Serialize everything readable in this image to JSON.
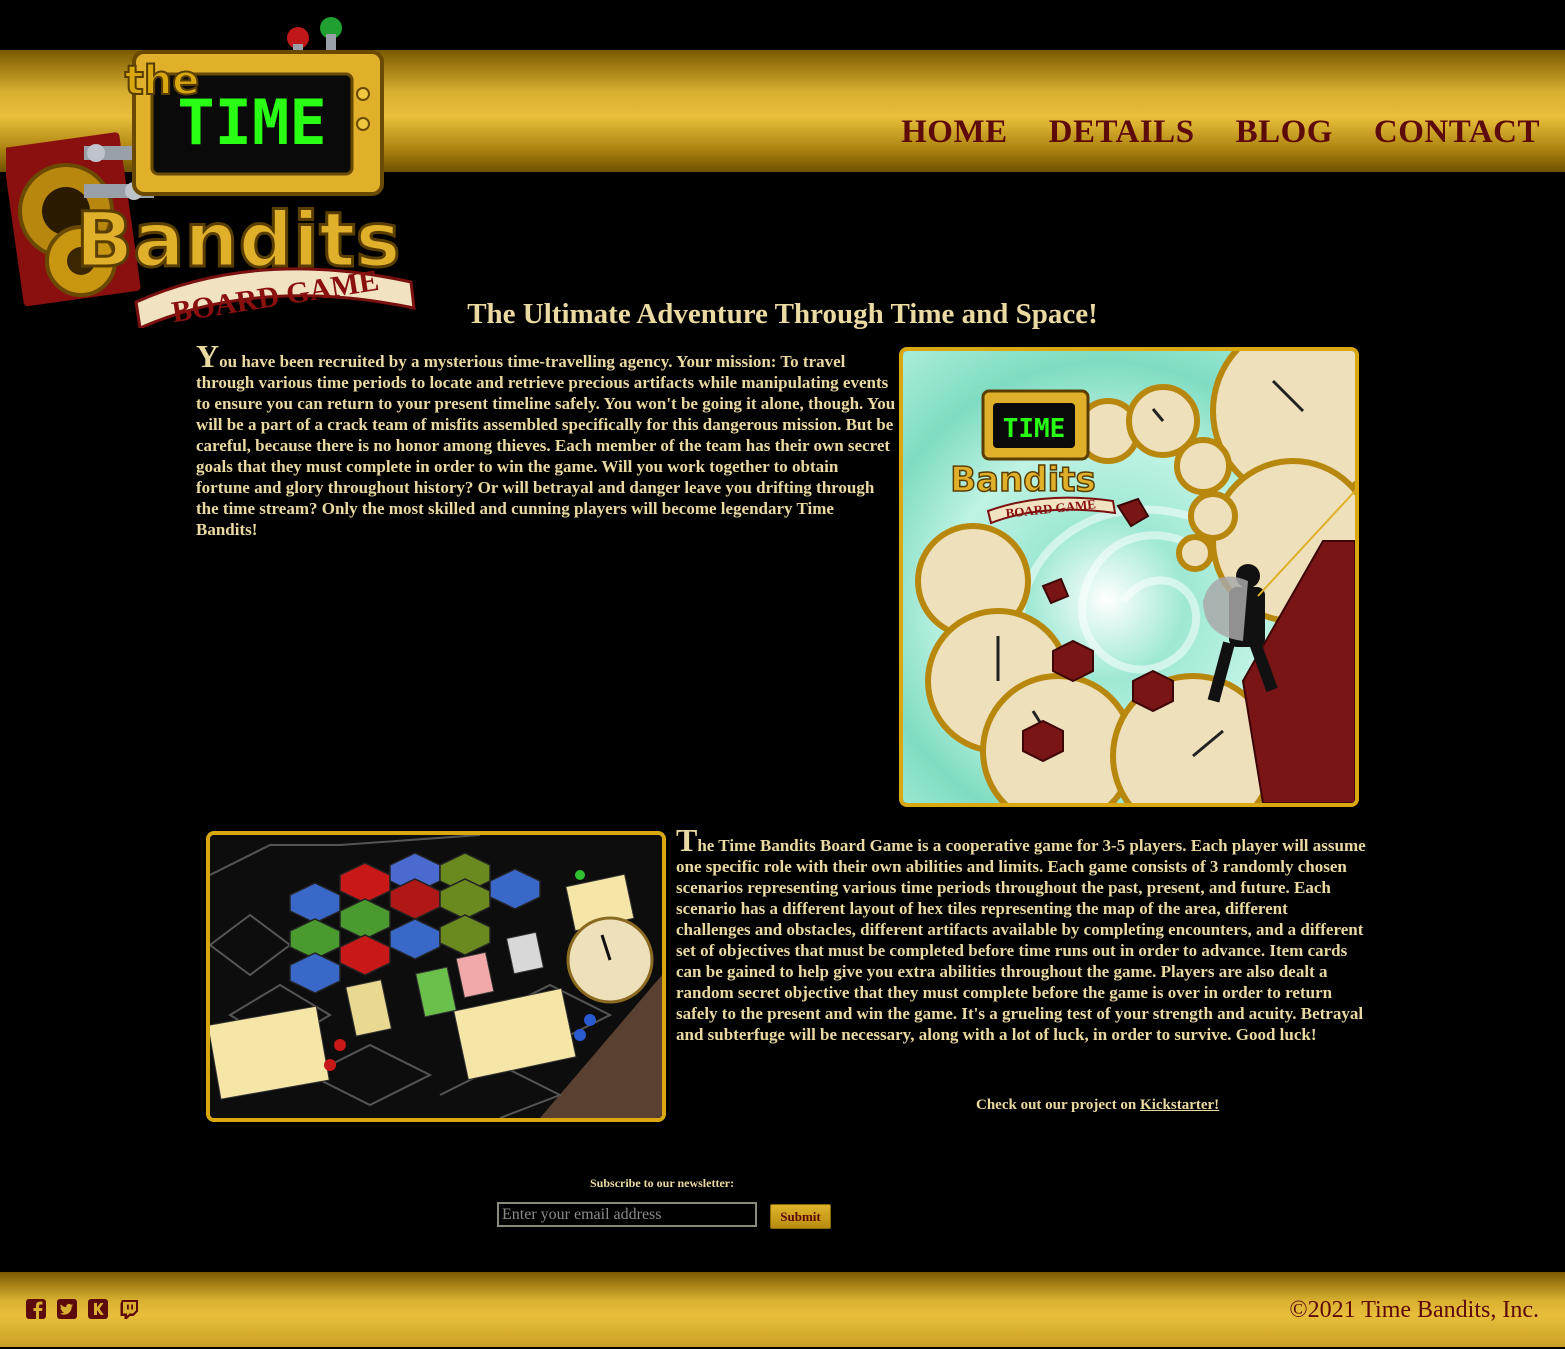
{
  "logo": {
    "the": "the",
    "time": "TIME",
    "bandits": "Bandits",
    "board_game": "BOARD GAME"
  },
  "nav": {
    "items": [
      "HOME",
      "DETAILS",
      "BLOG",
      "CONTACT"
    ]
  },
  "main": {
    "title": "The Ultimate Adventure Through Time and Space!",
    "intro": {
      "dropcap": "Y",
      "text": "ou have been recruited by a mysterious time-travelling agency. Your mission: To travel through various time periods to locate and retrieve precious artifacts while manipulating events to ensure you can return to your present timeline safely. You won't be going it alone, though. You will be a part of a crack team of misfits assembled specifically for this dangerous mission. But be careful, because there is no honor among thieves. Each member of the team has their own secret goals that they must complete in order to win the game. Will you work together to obtain fortune and glory throughout history? Or will betrayal and danger leave you drifting through the time stream? Only the most skilled and cunning players will become legendary Time Bandits!"
    },
    "details": {
      "dropcap": "T",
      "text": "he Time Bandits Board Game is a cooperative game for 3-5 players. Each player will assume one specific role with their own abilities and limits. Each game consists of 3 randomly chosen scenarios representing various time periods throughout the past, present, and future. Each scenario has a different layout of hex tiles representing the map of the area, different challenges and obstacles, different artifacts available by completing encounters, and a different set of objectives that must be completed before time runs out in order to advance. Item cards can be gained to help give you extra abilities throughout the game. Players are also dealt a random secret objective that they must complete before the game is over in order to return safely to the present and win the game. It's a grueling test of your strength and acuity. Betrayal and subterfuge will be necessary, along with a lot of luck, in order to survive. Good luck!"
    },
    "kickstarter": {
      "prefix": "Check out our project on ",
      "link": "Kickstarter!"
    }
  },
  "newsletter": {
    "label": "Subscribe to our newsletter:",
    "placeholder": "Enter your email address",
    "submit": "Submit"
  },
  "footer": {
    "socials": [
      "facebook-icon",
      "twitter-icon",
      "kickstarter-icon",
      "twitch-icon"
    ],
    "copyright": "©2021 Time Bandits, Inc."
  },
  "colors": {
    "gold": "#d9b030",
    "maroon": "#5c0a0a",
    "text": "#ead9a0",
    "screen_green": "#28ff14"
  }
}
